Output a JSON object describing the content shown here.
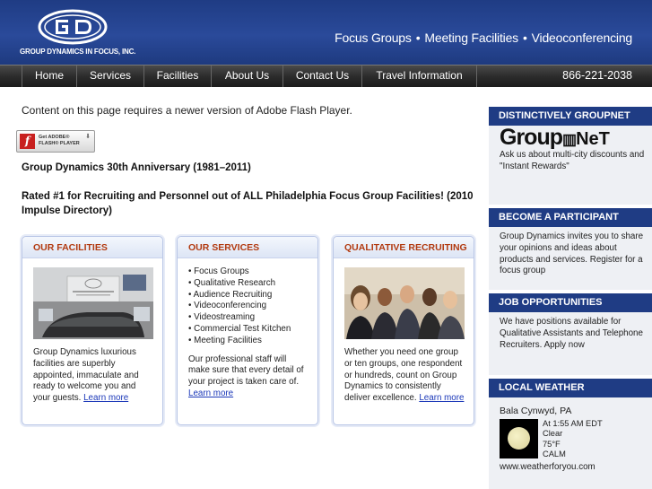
{
  "header": {
    "logo_text": "GROUP DYNAMICS IN FOCUS, INC.",
    "tagline": [
      "Focus Groups",
      "Meeting Facilities",
      "Videoconferencing"
    ],
    "brand_color": "#1f3c84"
  },
  "nav": {
    "items": [
      "Home",
      "Services",
      "Facilities",
      "About Us",
      "Contact Us",
      "Travel Information"
    ],
    "phone": "866-221-2038"
  },
  "main": {
    "flash_message": "Content on this page requires a newer version of Adobe Flash Player.",
    "flash_badge": {
      "line1": "Get ADOBE®",
      "line2": "FLASH® PLAYER"
    },
    "anniversary": "Group Dynamics 30th Anniversary (1981–2011)",
    "rated": "Rated #1 for Recruiting and Personnel out of ALL Philadelphia Focus Group Facilities! (2010 Impulse Directory)",
    "cards": [
      {
        "title": "OUR FACILITIES",
        "text": "Group Dynamics luxurious facilities are superbly appointed, immaculate and ready to welcome you and your guests.",
        "link": "Learn more"
      },
      {
        "title": "OUR SERVICES",
        "list": [
          "Focus Groups",
          "Qualitative Research",
          "Audience Recruiting",
          "Videoconferencing",
          "Videostreaming",
          "Commercial Test Kitchen",
          "Meeting Facilities"
        ],
        "text": "Our professional staff will make sure that every detail of your project is taken care of.",
        "link": "Learn more"
      },
      {
        "title": "QUALITATIVE RECRUITING",
        "text": "Whether you need one group or ten groups, one respondent or hundreds, count on Group Dynamics to consistently deliver excellence.",
        "link": "Learn more"
      }
    ]
  },
  "sidebar": {
    "groupnet": {
      "title": "DISTINCTIVELY GROUPNET",
      "logo_a": "Group",
      "logo_b": "NeT",
      "text": "Ask us about multi-city discounts and \"Instant Rewards\""
    },
    "participant": {
      "title": "BECOME A PARTICIPANT",
      "text": "Group Dynamics invites you to share your opinions and ideas about products and services.",
      "link": "Register for a focus group"
    },
    "jobs": {
      "title": "JOB OPPORTUNITIES",
      "text": "We have positions available for Qualitative Assistants and Telephone Recruiters.",
      "link": "Apply now"
    },
    "weather": {
      "title": "LOCAL WEATHER",
      "location": "Bala Cynwyd, PA",
      "time": "At 1:55 AM EDT",
      "condition": "Clear",
      "temp": "75°F",
      "wind": "CALM",
      "source": "www.weatherforyou.com"
    }
  }
}
